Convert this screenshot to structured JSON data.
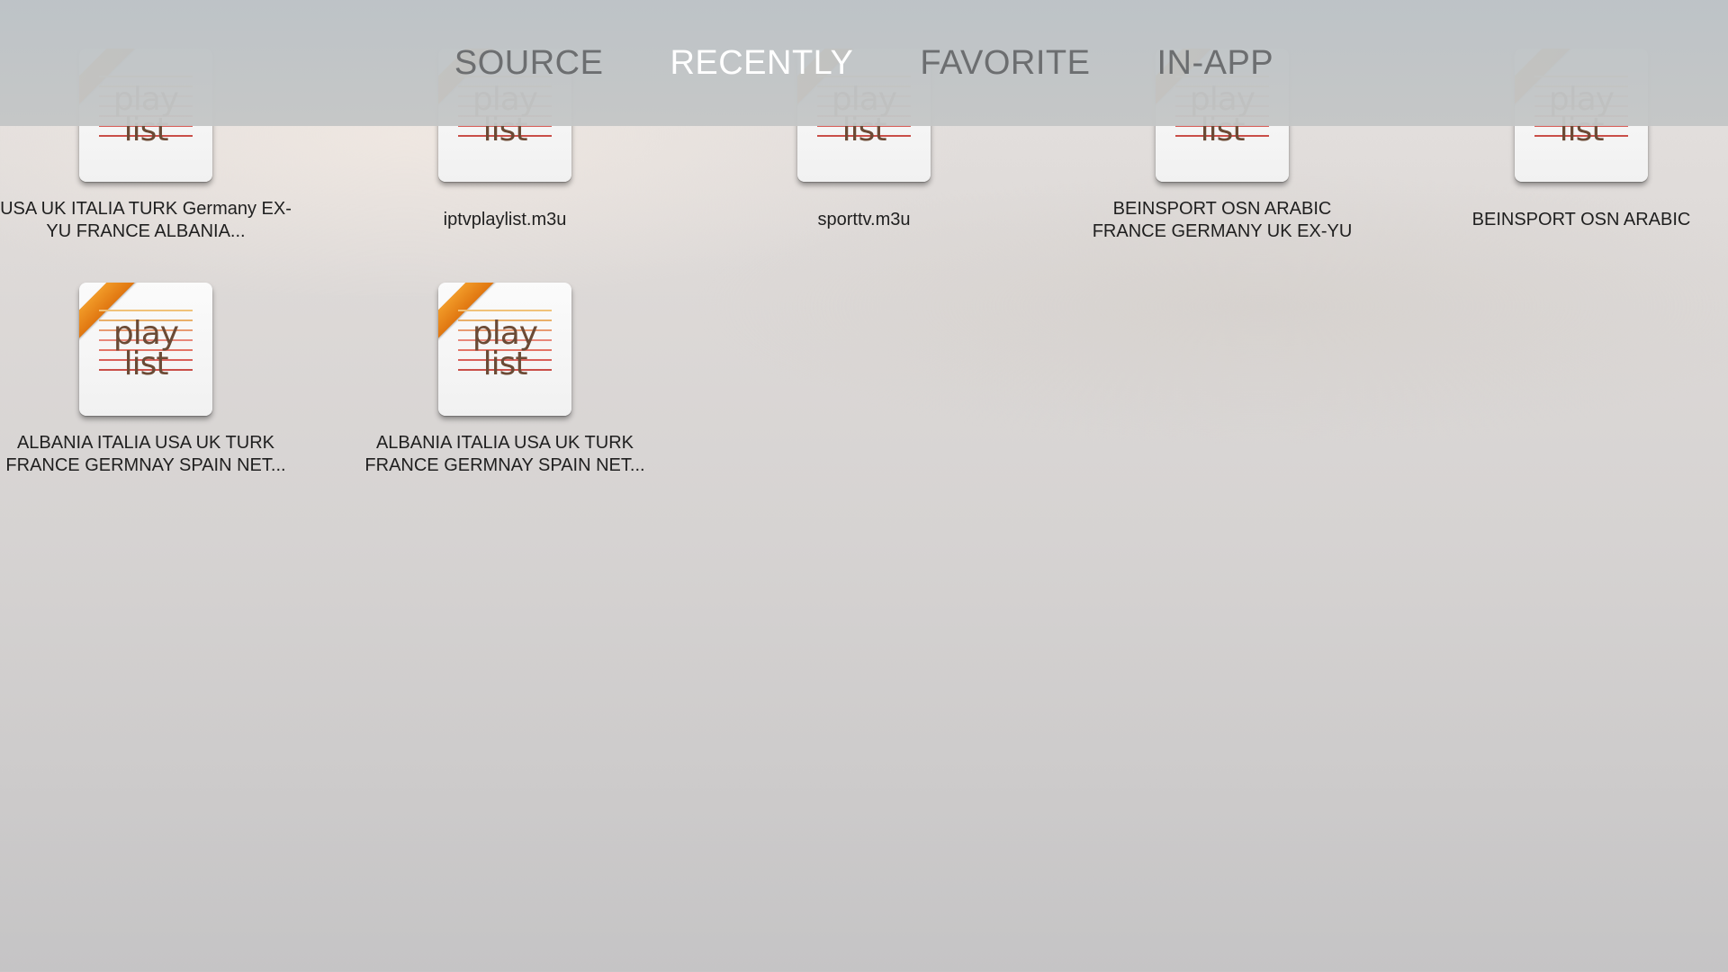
{
  "tabs": [
    {
      "label": "SOURCE",
      "active": false
    },
    {
      "label": "RECENTLY",
      "active": true
    },
    {
      "label": "FAVORITE",
      "active": false
    },
    {
      "label": "IN-APP",
      "active": false
    }
  ],
  "icon": {
    "word_top": "play",
    "word_bottom": "list",
    "ribbon_color": "#e8821a",
    "line_colors": [
      "#f0c27a",
      "#eab06a",
      "#e89a72",
      "#e8877a",
      "#e37466",
      "#d9605a",
      "#c94e48"
    ]
  },
  "playlists": [
    {
      "title": "USA UK ITALIA TURK Germany EX-YU FRANCE ALBANIA...",
      "ribbon": true
    },
    {
      "title": "iptvplaylist.m3u",
      "ribbon": true
    },
    {
      "title": "sporttv.m3u",
      "ribbon": true
    },
    {
      "title": "BEINSPORT OSN ARABIC FRANCE GERMANY UK EX-YU",
      "ribbon": true
    },
    {
      "title": "BEINSPORT OSN ARABIC",
      "ribbon": true
    },
    {
      "title": "ALBANIA ITALIA USA UK TURK FRANCE GERMNAY SPAIN NET...",
      "ribbon": true
    },
    {
      "title": "ALBANIA ITALIA USA UK TURK FRANCE GERMNAY SPAIN NET...",
      "ribbon": true
    }
  ]
}
